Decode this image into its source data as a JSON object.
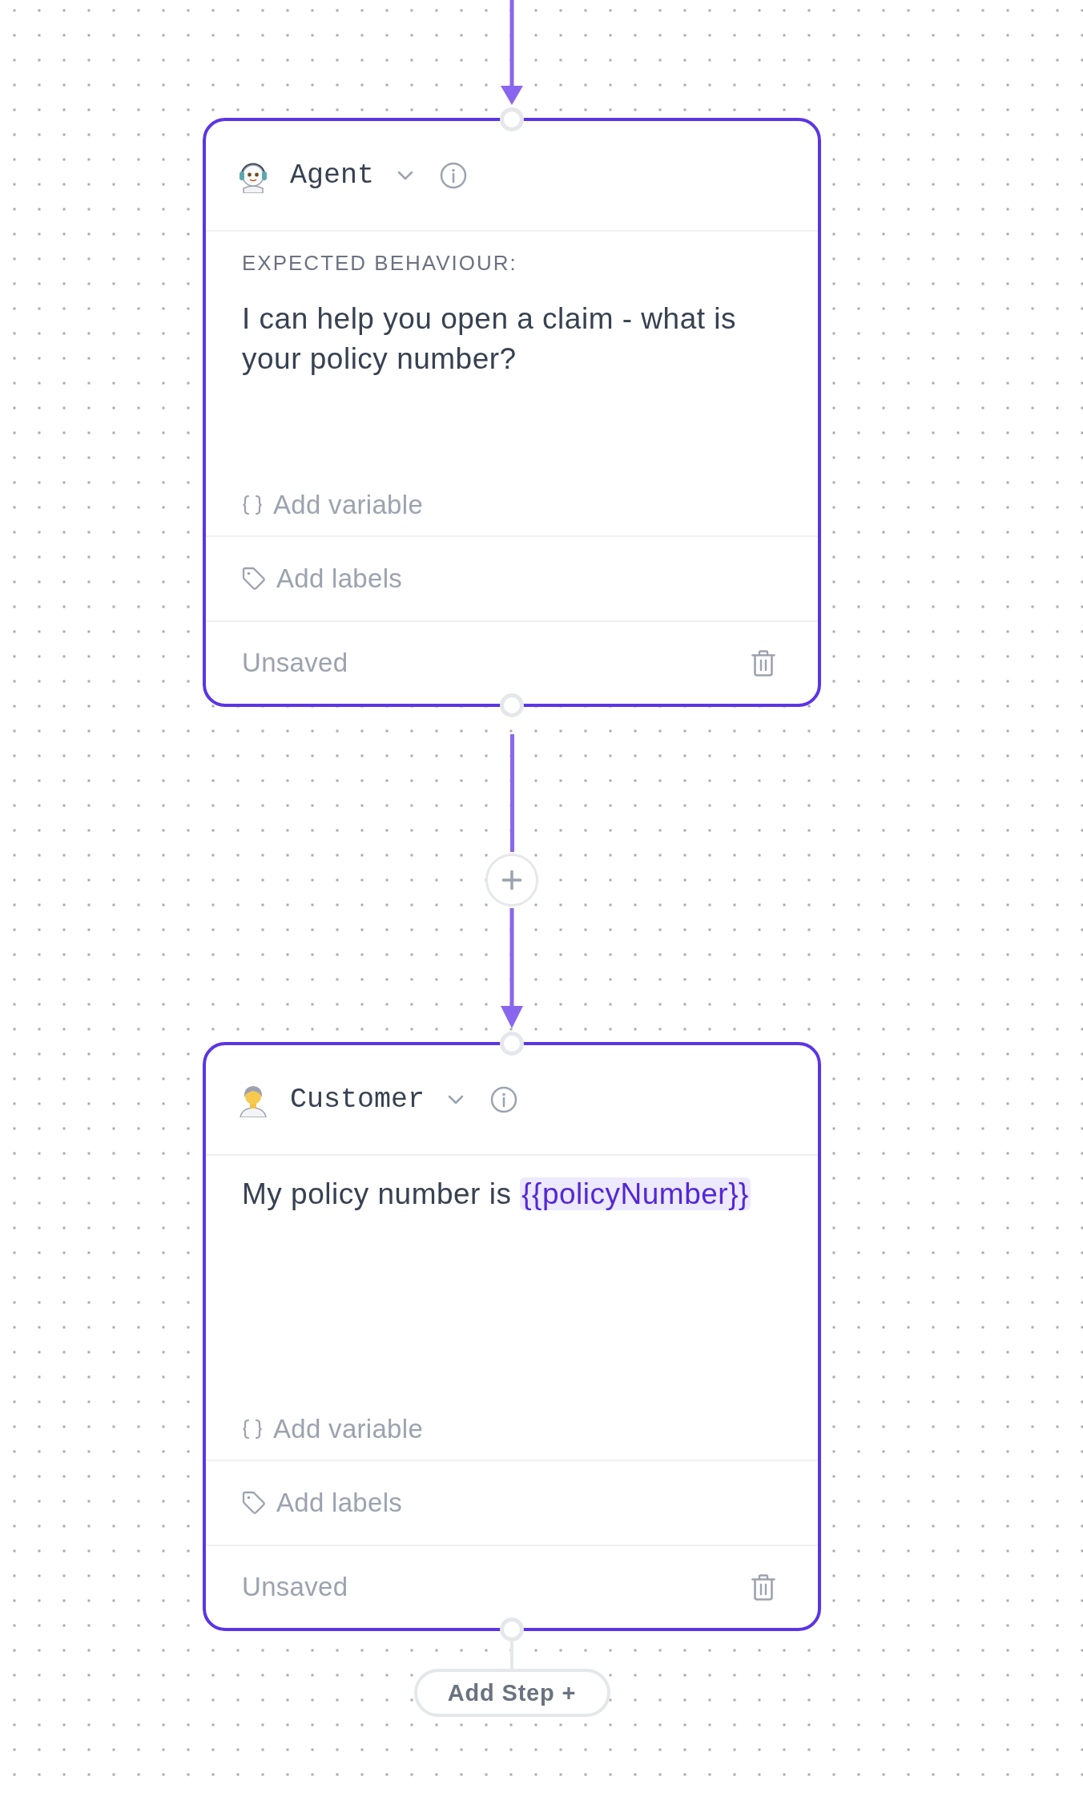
{
  "steps": [
    {
      "kind": "agent",
      "role": "Agent",
      "heading": "EXPECTED BEHAVIOUR:",
      "message": [
        {
          "kind": "text",
          "text": "I can help you open a claim - what is your policy number?"
        }
      ],
      "add_variable": "Add variable",
      "add_labels": "Add labels",
      "status": "Unsaved"
    },
    {
      "kind": "customer",
      "role": "Customer",
      "message": [
        {
          "kind": "text",
          "text": "My policy number is "
        },
        {
          "kind": "variable",
          "text": "{{policyNumber}}"
        }
      ],
      "add_variable": "Add variable",
      "add_labels": "Add labels",
      "status": "Unsaved"
    }
  ],
  "add_step": "Add Step +"
}
